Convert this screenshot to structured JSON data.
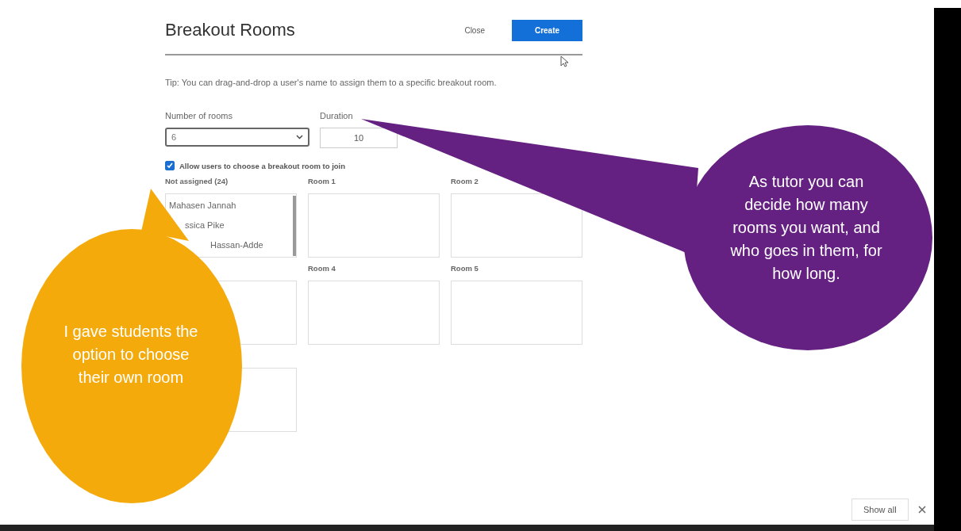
{
  "dialog": {
    "title": "Breakout Rooms",
    "close_button": "Close",
    "create_button": "Create",
    "tip": "Tip: You can drag-and-drop a user's name to assign them to a specific breakout room.",
    "rooms_field": {
      "label": "Number of rooms",
      "value": "6"
    },
    "duration_field": {
      "label": "Duration",
      "value": "10"
    },
    "allow_choice": {
      "label": "Allow users to choose a breakout room to join",
      "checked": true
    },
    "rooms": [
      {
        "kind": "unassigned",
        "label": "Not assigned (24)",
        "members": [
          "Mahasen Jannah",
          "ssica Pike",
          "Hassan-Adde"
        ]
      },
      {
        "kind": "room",
        "label": "Room 1"
      },
      {
        "kind": "room",
        "label": "Room 2"
      },
      {
        "kind": "room"
      },
      {
        "kind": "room",
        "label": "Room 4"
      },
      {
        "kind": "room",
        "label": "Room 5"
      },
      {
        "kind": "room"
      }
    ]
  },
  "callouts": [
    {
      "text": "I gave students the option to choose their own room",
      "color": "#f5aa0c"
    },
    {
      "text": "As tutor you can decide how many rooms you want, and who goes in them, for how long.",
      "color": "#652181"
    }
  ],
  "download_bar": {
    "show_all_button": "Show all"
  }
}
